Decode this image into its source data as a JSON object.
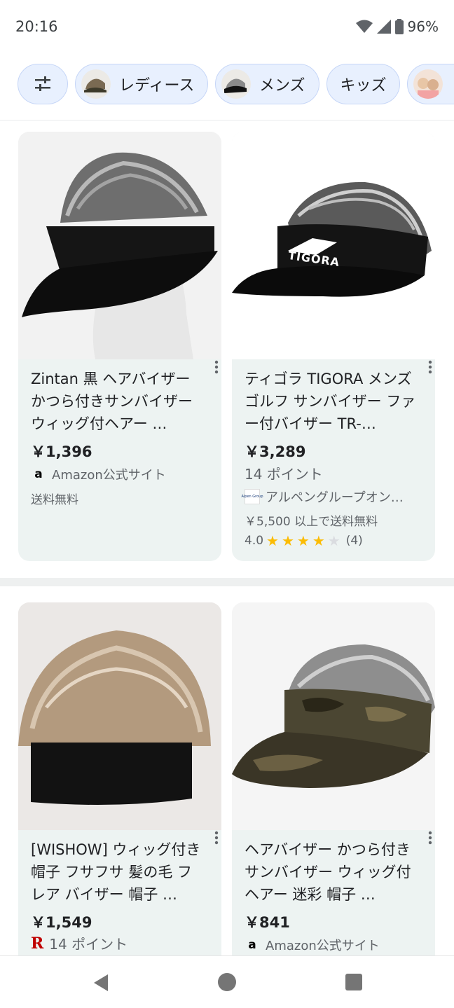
{
  "status_bar": {
    "time": "20:16",
    "battery": "96%"
  },
  "chips": [
    {
      "label": "レディース"
    },
    {
      "label": "メンズ"
    },
    {
      "label": "キッズ"
    }
  ],
  "products": [
    {
      "title": "Zintan 黒 ヘアバイザー かつら付きサンバイザー ウィッグ付ヘアー …",
      "price": "￥1,396",
      "seller": "Amazon公式サイト",
      "shipping": "送料無料"
    },
    {
      "title": "ティゴラ TIGORA メンズ ゴルフ サンバイザー ファー付バイザー TR-…",
      "price": "￥3,289",
      "points": "14 ポイント",
      "seller": "アルペングループオン…",
      "seller_logo_text": "Alpen Group",
      "shipping": "￥5,500 以上で送料無料",
      "rating": "4.0",
      "reviews": "(4)",
      "brand_text": "TIGORA"
    },
    {
      "title": "[WISHOW] ウィッグ付き帽子 フサフサ 髪の毛 フレア バイザー 帽子 …",
      "price": "￥1,549",
      "points": "14 ポイント"
    },
    {
      "title": "ヘアバイザー かつら付きサンバイザー ウィッグ付ヘアー 迷彩 帽子 …",
      "price": "￥841",
      "seller": "Amazon公式サイト"
    }
  ],
  "colors": {
    "chip_bg": "#e8f0fe",
    "card_bg": "#edf3f2",
    "star": "#fbbc04"
  }
}
